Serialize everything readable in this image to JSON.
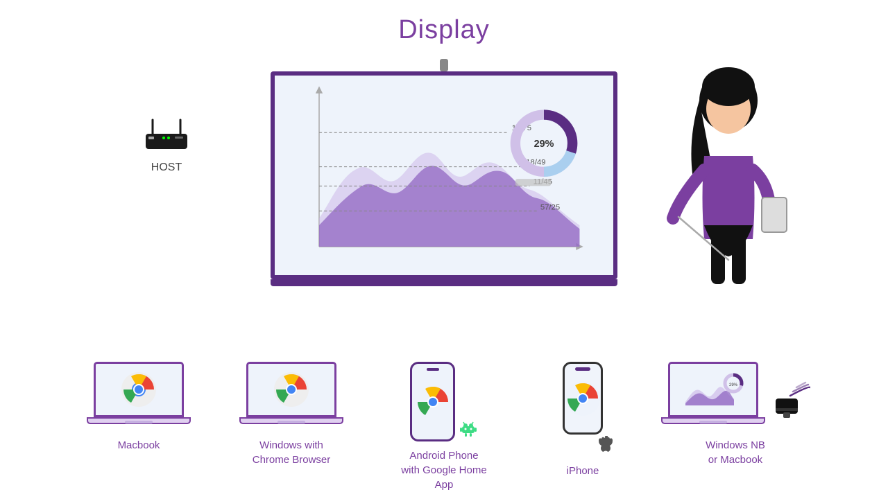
{
  "title": "Display",
  "host": {
    "label": "HOST"
  },
  "chart": {
    "data_points": [
      {
        "label": "16/75",
        "value": 75
      },
      {
        "label": "18/49",
        "value": 49
      },
      {
        "label": "11/45",
        "value": 45
      },
      {
        "label": "57/25",
        "value": 25
      }
    ],
    "donut_percent": "29%"
  },
  "devices": [
    {
      "id": "macbook",
      "label": "Macbook",
      "type": "laptop"
    },
    {
      "id": "windows-chrome",
      "label": "Windows with\nChrome Browser",
      "type": "laptop"
    },
    {
      "id": "android",
      "label": "Android Phone\nwith Google Home\nApp",
      "type": "android"
    },
    {
      "id": "iphone",
      "label": "iPhone",
      "type": "iphone"
    },
    {
      "id": "windows-nb",
      "label": "Windows NB\nor Macbook",
      "type": "laptop-dongle"
    }
  ]
}
